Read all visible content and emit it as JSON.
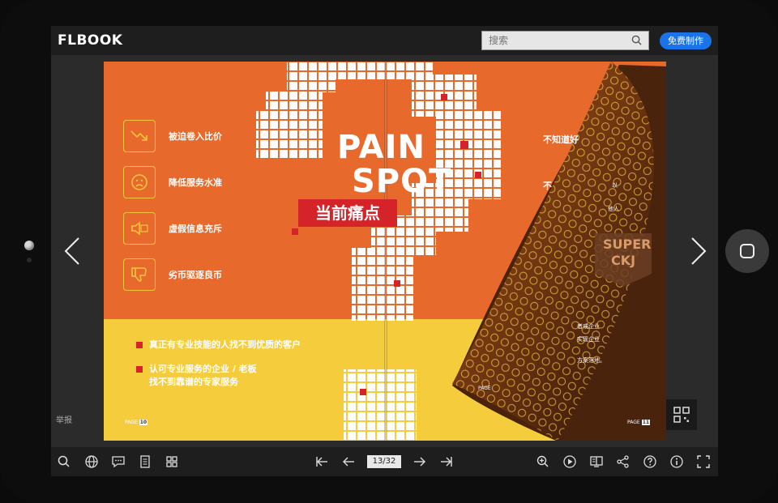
{
  "app": {
    "logo_text": "FLBOOK"
  },
  "header": {
    "search_placeholder": "搜索",
    "make_button": "免费制作"
  },
  "left_page": {
    "title_line1": "PAIN",
    "title_line2": "SPOT",
    "subtitle": "当前痛点",
    "features": [
      {
        "icon": "chart-down-icon",
        "label": "被迫卷入比价"
      },
      {
        "icon": "sad-face-icon",
        "label": "降低服务水准"
      },
      {
        "icon": "speaker-fake-icon",
        "label": "虚假信息充斥"
      },
      {
        "icon": "thumbs-down-icon",
        "label": "劣币驱逐良币"
      }
    ],
    "bullets": [
      {
        "line1": "真正有专业技能的人找不到优质的客户",
        "line2": ""
      },
      {
        "line1": "认可专业服务的企业 / 老板",
        "line2": "找不到靠谱的专家服务"
      }
    ],
    "page_label": "PAGE",
    "page_number": "10"
  },
  "right_page": {
    "texts": [
      "不知道好",
      "不",
      "以",
      "他人",
      "者或企业",
      "实现企业",
      "方案落地。"
    ],
    "brand_text1": "SUPER",
    "brand_text2": "CKJ",
    "page_label": "PAGE",
    "page_number": "11",
    "curl_page_label": "PAGE"
  },
  "controls": {
    "report_link": "举报",
    "page_indicator": "13/32"
  },
  "colors": {
    "orange": "#e8692c",
    "yellow": "#f5cd3c",
    "red": "#d4242a",
    "accent_blue": "#1a73e8"
  }
}
